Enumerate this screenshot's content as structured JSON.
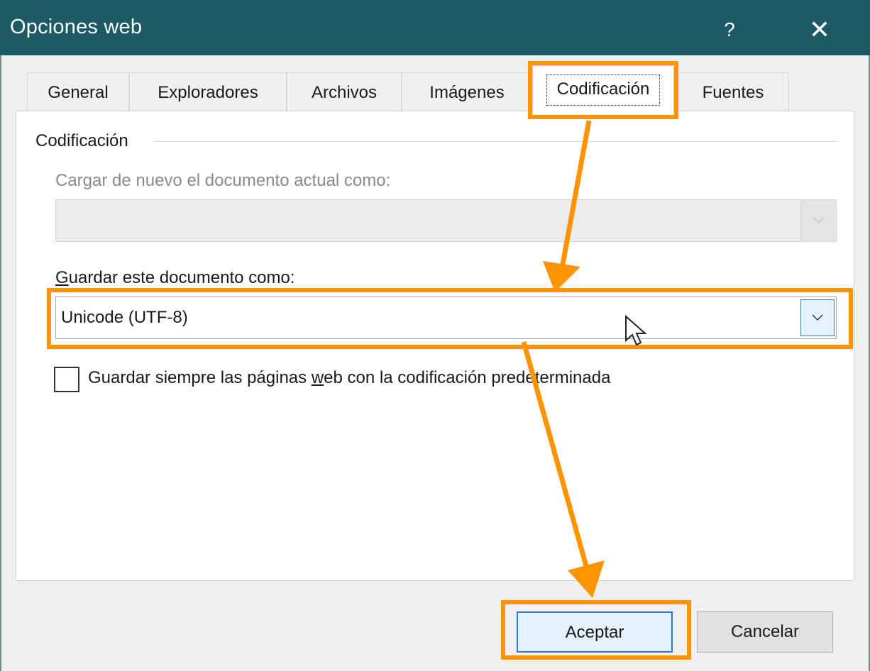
{
  "window": {
    "title": "Opciones web",
    "help_label": "?",
    "close_label": "✕"
  },
  "tabs": [
    {
      "label": "General"
    },
    {
      "label": "Exploradores"
    },
    {
      "label": "Archivos"
    },
    {
      "label": "Imágenes"
    },
    {
      "label": "Codificación",
      "active": true
    },
    {
      "label": "Fuentes"
    }
  ],
  "encoding": {
    "group_label": "Codificación",
    "reload_label": "Cargar de nuevo el documento actual como:",
    "reload_value": "",
    "save_label": "Guardar este documento como:",
    "save_value": "Unicode (UTF-8)",
    "always_save_label": "Guardar siempre las páginas web con la codificación predeterminada",
    "always_save_checked": false
  },
  "buttons": {
    "ok_label": "Aceptar",
    "cancel_label": "Cancelar"
  },
  "annotation": {
    "highlight_color": "#ff9400"
  }
}
